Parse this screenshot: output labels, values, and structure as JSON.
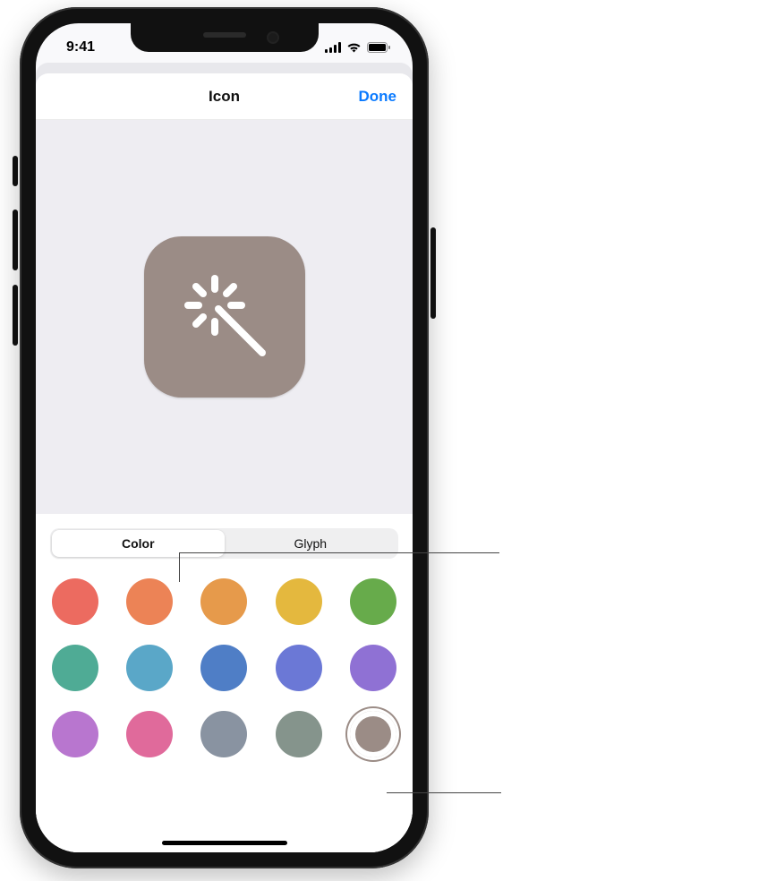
{
  "status": {
    "time": "9:41"
  },
  "nav": {
    "title": "Icon",
    "done": "Done"
  },
  "preview": {
    "icon_color": "#9b8c86",
    "glyph": "magic-wand-icon"
  },
  "segments": {
    "color": "Color",
    "glyph": "Glyph",
    "selected": "color"
  },
  "colors": [
    {
      "hex": "#ec6b60",
      "name": "red"
    },
    {
      "hex": "#ec8356",
      "name": "orange-red"
    },
    {
      "hex": "#e69a4b",
      "name": "orange"
    },
    {
      "hex": "#e4b83e",
      "name": "yellow"
    },
    {
      "hex": "#67ab4b",
      "name": "green"
    },
    {
      "hex": "#4fab95",
      "name": "teal"
    },
    {
      "hex": "#5aa7c8",
      "name": "light-blue"
    },
    {
      "hex": "#4f7ec6",
      "name": "blue"
    },
    {
      "hex": "#6b78d6",
      "name": "indigo"
    },
    {
      "hex": "#8f71d4",
      "name": "violet"
    },
    {
      "hex": "#b876cf",
      "name": "purple"
    },
    {
      "hex": "#e06a9b",
      "name": "pink"
    },
    {
      "hex": "#8993a1",
      "name": "slate"
    },
    {
      "hex": "#85948c",
      "name": "sage"
    },
    {
      "hex": "#9b8c86",
      "name": "taupe",
      "selected": true
    }
  ]
}
